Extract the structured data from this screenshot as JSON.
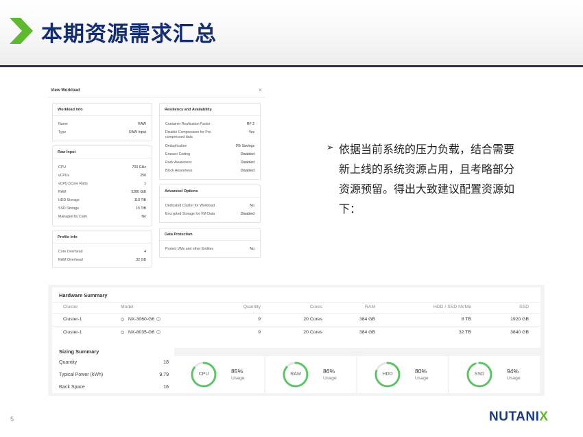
{
  "slide": {
    "title": "本期资源需求汇总",
    "page_number": "5",
    "bullet": "依据当前系统的压力负载，结合需要新上线的系统资源占用，且考略部分资源预留。得出大致建议配置资源如下：",
    "logo_main": "NUTANI",
    "logo_x": "X",
    "accent_color": "#5fb830",
    "title_color": "#162d6d"
  },
  "workload": {
    "title": "View Workload",
    "close": "×",
    "workload_info": {
      "title": "Workload Info",
      "rows": [
        {
          "k": "Name",
          "v": "RAW"
        },
        {
          "k": "Type",
          "v": "RAW Input"
        }
      ]
    },
    "raw_input": {
      "title": "Raw Input",
      "rows": [
        {
          "k": "CPU",
          "v": "700 GHz"
        },
        {
          "k": "vCPUs",
          "v": "250"
        },
        {
          "k": "vCPU:pCore Ratio",
          "v": "1"
        },
        {
          "k": "RAM",
          "v": "5280 GiB"
        },
        {
          "k": "HDD Storage",
          "v": "110 TiB"
        },
        {
          "k": "SSD Storage",
          "v": "15 TiB"
        },
        {
          "k": "Managed by Calm",
          "v": "No"
        }
      ]
    },
    "profile_info": {
      "title": "Profile Info",
      "rows": [
        {
          "k": "Core Overhead",
          "v": "4"
        },
        {
          "k": "RAM Overhead",
          "v": "32 GB"
        }
      ]
    },
    "resiliency": {
      "title": "Resiliency and Availability",
      "rows": [
        {
          "k": "Container Replication Factor",
          "v": "RF 2"
        },
        {
          "k": "Disable Compression for Pre-compressed data",
          "v": "Yes"
        },
        {
          "k": "Deduplication",
          "v": "0% Savings"
        },
        {
          "k": "Erasure Coding",
          "v": "Disabled"
        },
        {
          "k": "Rack Awareness",
          "v": "Disabled"
        },
        {
          "k": "Block Awareness",
          "v": "Disabled"
        }
      ]
    },
    "advanced": {
      "title": "Advanced Options",
      "rows": [
        {
          "k": "Dedicated Cluster for Workload",
          "v": "No"
        },
        {
          "k": "Encrypted Storage for VM Data",
          "v": "Disabled"
        }
      ]
    },
    "protection": {
      "title": "Data Protection",
      "rows": [
        {
          "k": "Protect VMs and other Entities",
          "v": "No"
        }
      ]
    }
  },
  "hardware": {
    "title": "Hardware Summary",
    "headers": {
      "cluster": "Cluster",
      "model": "Model",
      "quantity": "Quantity",
      "cores": "Cores",
      "ram": "RAM",
      "hdd": "HDD / SSD NVMe",
      "ssd": "SSD"
    },
    "rows": [
      {
        "cluster": "Cluster-1",
        "model": "NX-3060-G6",
        "quantity": "9",
        "cores": "20 Cores",
        "ram": "384 GB",
        "hdd": "8 TB",
        "ssd": "1920 GB"
      },
      {
        "cluster": "Cluster-1",
        "model": "NX-8035-G6",
        "quantity": "9",
        "cores": "20 Cores",
        "ram": "384 GB",
        "hdd": "32 TB",
        "ssd": "3840 GB"
      }
    ]
  },
  "sizing": {
    "title": "Sizing Summary",
    "rows": [
      {
        "k": "Quantity",
        "v": "18"
      },
      {
        "k": "Typical Power (kWh)",
        "v": "9.79"
      },
      {
        "k": "Rack Space",
        "v": "16"
      }
    ],
    "gauges": [
      {
        "label": "CPU",
        "pct": "85%",
        "usage": "Usage",
        "value": 0.85
      },
      {
        "label": "RAM",
        "pct": "86%",
        "usage": "Usage",
        "value": 0.86
      },
      {
        "label": "HDD",
        "pct": "80%",
        "usage": "Usage",
        "value": 0.8
      },
      {
        "label": "SSD",
        "pct": "94%",
        "usage": "Usage",
        "value": 0.94
      }
    ],
    "gauge_color": "#5fc468"
  }
}
